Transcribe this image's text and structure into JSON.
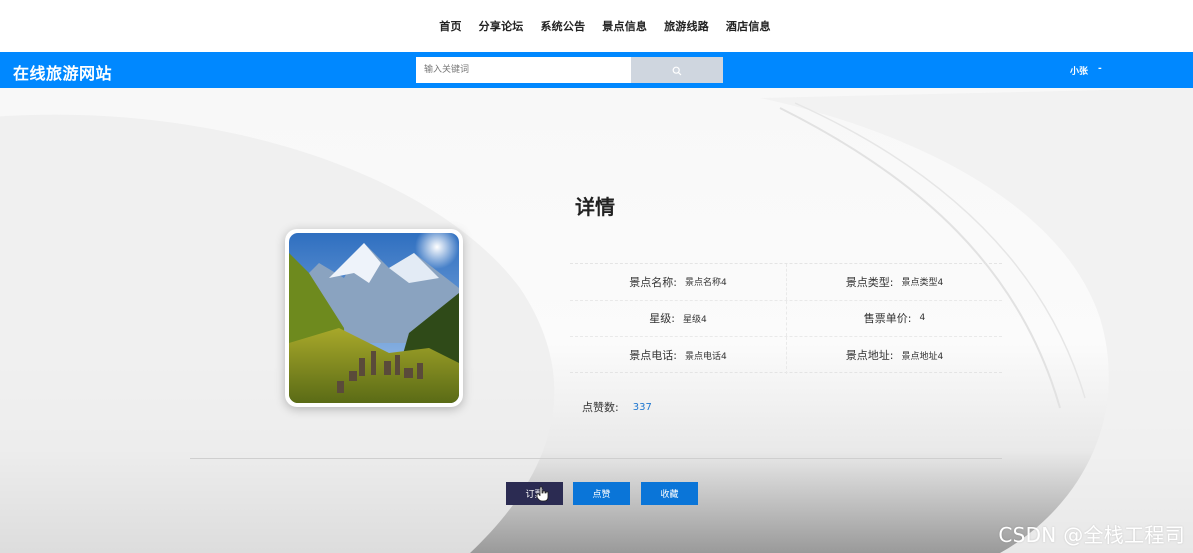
{
  "nav": {
    "items": [
      "首页",
      "分享论坛",
      "系统公告",
      "景点信息",
      "旅游线路",
      "酒店信息"
    ]
  },
  "header": {
    "site_title": "在线旅游网站",
    "search_placeholder": "输入关键词",
    "search_icon": "search-icon",
    "user_name": "小张",
    "user_suffix": "-"
  },
  "detail": {
    "title": "详情",
    "fields": [
      {
        "label": "景点名称:",
        "value": "景点名称4"
      },
      {
        "label": "景点类型:",
        "value": "景点类型4"
      },
      {
        "label": "星级:",
        "value": "星级4"
      },
      {
        "label": "售票单价:",
        "value": "4"
      },
      {
        "label": "景点电话:",
        "value": "景点电话4"
      },
      {
        "label": "景点地址:",
        "value": "景点地址4"
      }
    ],
    "likes_label": "点赞数:",
    "likes_value": "337"
  },
  "actions": {
    "order": "订票",
    "like": "点赞",
    "favorite": "收藏"
  },
  "watermark": "CSDN @全栈工程司",
  "colors": {
    "primary": "#0088ff",
    "button_blue": "#0a75d8",
    "button_dark": "#2b2b52",
    "link": "#1f77d0"
  }
}
